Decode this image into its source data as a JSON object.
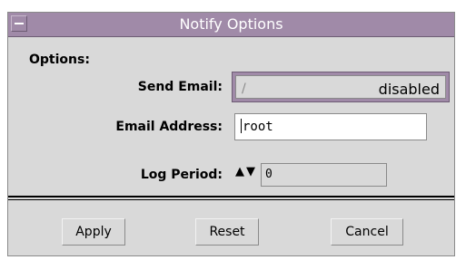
{
  "window": {
    "title": "Notify Options"
  },
  "section": {
    "heading": "Options:"
  },
  "fields": {
    "send_email_label": "Send Email:",
    "send_email_value": "disabled",
    "email_label": "Email Address:",
    "email_value": "root",
    "log_period_label": "Log Period:",
    "log_period_value": "0",
    "spin_up": "▲",
    "spin_down": "▼"
  },
  "buttons": {
    "apply": "Apply",
    "reset": "Reset",
    "cancel": "Cancel"
  },
  "colors": {
    "titlebar": "#a08aa8",
    "panel": "#d9d9d9"
  },
  "icons": {
    "window_menu": "window-menu-icon",
    "toggle": "toggle-indicator-icon",
    "spin": "spin-arrows-icon"
  }
}
